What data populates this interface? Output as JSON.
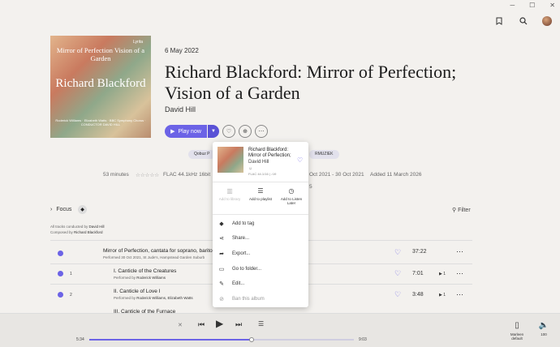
{
  "window": {
    "minimize": "─",
    "maximize": "☐",
    "close": "✕"
  },
  "album": {
    "cover_label_publisher": "Lyrita",
    "cover_subtitle": "Mirror of Perfection Vision of a Garden",
    "cover_composer": "Richard Blackford",
    "cover_credits": "Roderick Williams · Elizabeth Watts · BBC Symphony Chorus · CONDUCTOR DAVID HILL",
    "release_date": "6 May 2022",
    "title": "Richard Blackford: Mirror of Perfection; Vision of a Garden",
    "artist": "David Hill",
    "play_label": "Play now",
    "tags": [
      "Qobuz P",
      "RMUZIEK"
    ],
    "duration": "53 minutes",
    "stars": "☆☆☆☆☆",
    "format": "FLAC 44.1kHz 16bit",
    "recorded": "Oct 2021 - 30 Oct 2021",
    "recorded_dash": "5",
    "added": "Added 11 March 2026"
  },
  "filters": {
    "focus": "Focus",
    "filter": "Filter"
  },
  "credits": {
    "line1_prefix": "All tracks conducted by",
    "line1_name": "David Hill",
    "line2_prefix": "Composed by",
    "line2_name": "Richard Blackford"
  },
  "tracks": [
    {
      "num": "",
      "name": "Mirror of Perfection, cantata for soprano, baritone",
      "sub_prefix": "Performed 30 Oct 2021, St Jude's, Hampstead Garden Suburb",
      "sub_name": "",
      "duration": "37:22"
    },
    {
      "num": "1",
      "name": "I. Canticle of the Creatures",
      "sub_prefix": "Performed by",
      "sub_name": "Roderick Williams",
      "duration": "7:01"
    },
    {
      "num": "2",
      "name": "II. Canticle of Love I",
      "sub_prefix": "Performed by",
      "sub_name": "Roderick Williams, Elizabeth Watts",
      "duration": "3:48"
    },
    {
      "num": "",
      "name": "III. Canticle of the Furnace",
      "sub_prefix": "",
      "sub_name": "",
      "duration": ""
    }
  ],
  "context_menu": {
    "title": "Richard Blackford: Mirror of Perfection;",
    "artist": "David Hill",
    "quality_icon": "☺",
    "format": "FLAC 44.1/16 | ♪19",
    "actions": [
      {
        "label": "Add to library",
        "icon": "library-icon",
        "glyph": "▥",
        "disabled": true
      },
      {
        "label": "Add to playlist",
        "icon": "playlist-add-icon",
        "glyph": "☰",
        "disabled": false
      },
      {
        "label": "Add to Listen Later",
        "icon": "clock-icon",
        "glyph": "◷",
        "disabled": false
      }
    ],
    "items": [
      {
        "label": "Add to tag",
        "icon": "tag-icon",
        "glyph": "◆",
        "disabled": false
      },
      {
        "label": "Share...",
        "icon": "share-icon",
        "glyph": "⋖",
        "disabled": false
      },
      {
        "label": "Export...",
        "icon": "export-icon",
        "glyph": "➦",
        "disabled": false
      },
      {
        "label": "Go to folder...",
        "icon": "folder-icon",
        "glyph": "▭",
        "disabled": false
      },
      {
        "label": "Edit...",
        "icon": "pencil-icon",
        "glyph": "✎",
        "disabled": false
      },
      {
        "label": "Ban this album",
        "icon": "ban-icon",
        "glyph": "⊘",
        "disabled": true
      }
    ]
  },
  "player": {
    "elapsed": "5:34",
    "total": "9:03",
    "progress": 0.615,
    "output_label": "Marleen default",
    "volume": "100"
  },
  "colors": {
    "accent": "#6c63e6",
    "background": "#f3f1ee"
  }
}
